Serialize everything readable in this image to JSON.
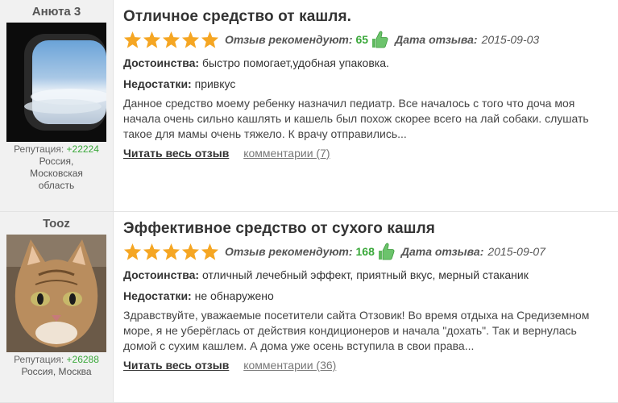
{
  "reviews": [
    {
      "username": "Анюта 3",
      "reputation_label": "Репутация:",
      "reputation_value": "+22224",
      "location": "Россия, Московская область",
      "title": "Отличное средство от кашля.",
      "recommend_label": "Отзыв рекомендуют:",
      "recommend_count": "65",
      "date_label": "Дата отзыва:",
      "date_value": "2015-09-03",
      "rating": 5,
      "pros_label": "Достоинства:",
      "pros_value": "быстро помогает,удобная упаковка.",
      "cons_label": "Недостатки:",
      "cons_value": "привкус",
      "body": "Данное средство моему ребенку назначил педиатр. Все началось с того что доча моя начала очень сильно кашлять и кашель был похож скорее всего на лай собаки. слушать такое для мамы очень тяжело. К врачу отправились...",
      "read_all": "Читать весь отзыв",
      "comments": "комментарии (7)"
    },
    {
      "username": "Tooz",
      "reputation_label": "Репутация:",
      "reputation_value": "+26288",
      "location": "Россия, Москва",
      "title": "Эффективное средство от сухого кашля",
      "recommend_label": "Отзыв рекомендуют:",
      "recommend_count": "168",
      "date_label": "Дата отзыва:",
      "date_value": "2015-09-07",
      "rating": 5,
      "pros_label": "Достоинства:",
      "pros_value": "отличный лечебный эффект, приятный вкус, мерный стаканик",
      "cons_label": "Недостатки:",
      "cons_value": "не обнаружено",
      "body": "Здравствуйте, уважаемые посетители сайта Отзовик! Во время отдыха на Средиземном море, я не уберёглась от действия кондиционеров и начала \"дохать\". Так и вернулась домой с сухим кашлем. А дома уже осень вступила в свои права...",
      "read_all": "Читать весь отзыв",
      "comments": "комментарии (36)"
    }
  ],
  "colors": {
    "star": "#f5a623",
    "accent_green": "#3aa83a"
  }
}
